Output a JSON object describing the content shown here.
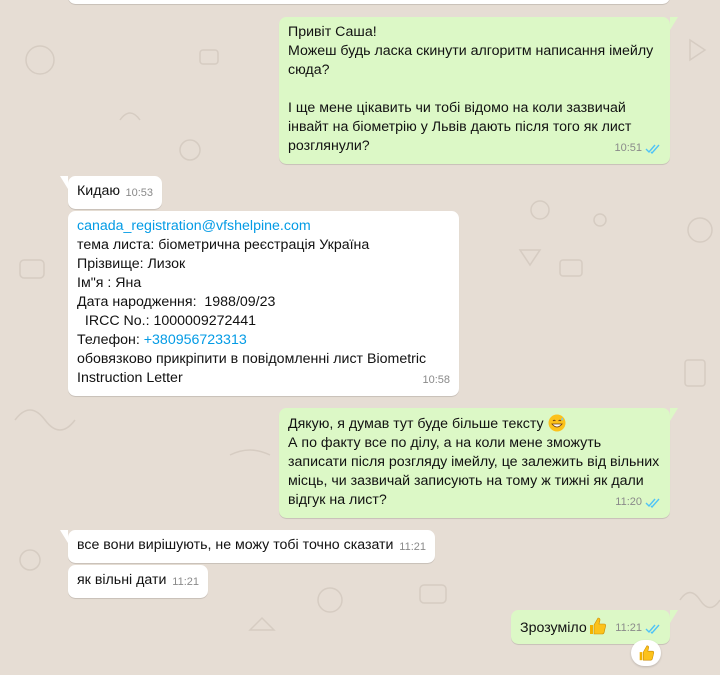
{
  "messages": [
    {
      "direction": "outgoing",
      "lines": [
        "Привіт Саша!",
        "Можеш будь ласка скинути алгоритм написання імейлу сюда?",
        "",
        "І ще мене цікавить чи тобі відомо на коли зазвичай інвайт на біометрію у Львів дають після того як лист розглянули?"
      ],
      "time": "10:51",
      "status_icon": "double-check-read"
    },
    {
      "direction": "incoming",
      "text": "Кидаю",
      "time": "10:53"
    },
    {
      "direction": "incoming",
      "email_link": "canada_registration@vfshelpine.com",
      "line_subject": "тема листа: біометрична реєстрація Україна",
      "line_surname": "Прізвище: Лизок",
      "line_name": "Ім\"я : Яна",
      "line_birth": "Дата народження:  1988/09/23",
      "line_ircc": "  IRCC No.: 1000009272441",
      "phone_label": "Телефон: ",
      "phone_link": "+380956723313",
      "line_attach": "обовязково прикріпити в повідомленні лист Biometric Instruction Letter",
      "time": "10:58"
    },
    {
      "direction": "outgoing",
      "line1": "Дякую, я думав тут буде більше тексту",
      "emoji1": "grinning-sweat-emoji",
      "line2": "А по факту все по ділу, а на коли мене зможуть записати після розгляду імейлу, це залежить від вільних місць, чи зазвичай записують на тому ж тижні як дали відгук на лист?",
      "time": "11:20",
      "status_icon": "double-check-read"
    },
    {
      "direction": "incoming",
      "text": "все вони вирішують, не можу тобі точно сказати",
      "time": "11:21"
    },
    {
      "direction": "incoming",
      "text": "як вільні дати",
      "time": "11:21"
    },
    {
      "direction": "outgoing",
      "text": "Зрозуміло",
      "emoji": "thumbs-up-emoji",
      "time": "11:21",
      "status_icon": "double-check-read",
      "reaction": "thumbs-up-emoji"
    }
  ],
  "colors": {
    "background": "#e6ddd4",
    "incoming_bubble": "#ffffff",
    "outgoing_bubble": "#dcf8c6",
    "read_ticks": "#4fc3f7",
    "link": "#039be5"
  }
}
